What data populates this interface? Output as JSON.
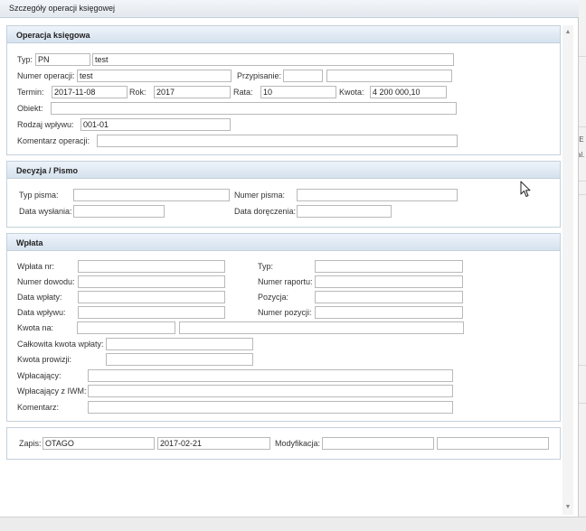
{
  "dialog": {
    "title": "Szczegóły operacji księgowej"
  },
  "background": {
    "text1": "IE",
    "text2": "al."
  },
  "operacja": {
    "header": "Operacja księgowa",
    "typ_label": "Typ:",
    "typ_code": "PN",
    "typ_name": "test",
    "numer_operacji_label": "Numer operacji:",
    "numer_operacji": "test",
    "przypisanie_label": "Przypisanie:",
    "przypisanie_1": "",
    "przypisanie_2": "",
    "termin_label": "Termin:",
    "termin": "2017-11-08",
    "rok_label": "Rok:",
    "rok": "2017",
    "rata_label": "Rata:",
    "rata": "10",
    "kwota_label": "Kwota:",
    "kwota": "4 200 000,10",
    "obiekt_label": "Obiekt:",
    "obiekt": "",
    "rodzaj_wplywu_label": "Rodzaj wpływu:",
    "rodzaj_wplywu": "001-01",
    "komentarz_label": "Komentarz operacji:",
    "komentarz": ""
  },
  "decyzja": {
    "header": "Decyzja / Pismo",
    "typ_pisma_label": "Typ pisma:",
    "typ_pisma": "",
    "numer_pisma_label": "Numer pisma:",
    "numer_pisma": "",
    "data_wyslania_label": "Data wysłania:",
    "data_wyslania": "",
    "data_doreczenia_label": "Data doręczenia:",
    "data_doreczenia": ""
  },
  "wplata": {
    "header": "Wpłata",
    "wplata_nr_label": "Wpłata nr:",
    "wplata_nr": "",
    "typ_label": "Typ:",
    "typ": "",
    "numer_dowodu_label": "Numer dowodu:",
    "numer_dowodu": "",
    "numer_raportu_label": "Numer raportu:",
    "numer_raportu": "",
    "data_wplaty_label": "Data wpłaty:",
    "data_wplaty": "",
    "pozycja_label": "Pozycja:",
    "pozycja": "",
    "data_wplywu_label": "Data wpływu:",
    "data_wplywu": "",
    "numer_pozycji_label": "Numer pozycji:",
    "numer_pozycji": "",
    "kwota_na_label": "Kwota na:",
    "kwota_na_1": "",
    "kwota_na_2": "",
    "calkowita_kwota_label": "Całkowita kwota wpłaty:",
    "calkowita_kwota": "",
    "kwota_prowizji_label": "Kwota prowizji:",
    "kwota_prowizji": "",
    "wplacajacy_label": "Wpłacający:",
    "wplacajacy": "",
    "wplacajacy_iwm_label": "Wpłacający z IWM:",
    "wplacajacy_iwm": "",
    "komentarz_label": "Komentarz:",
    "komentarz": ""
  },
  "zapis": {
    "zapis_label": "Zapis:",
    "zapis_user": "OTAGO",
    "zapis_date": "2017-02-21",
    "modyfikacja_label": "Modyfikacja:",
    "modyfikacja_user": "",
    "modyfikacja_date": ""
  }
}
